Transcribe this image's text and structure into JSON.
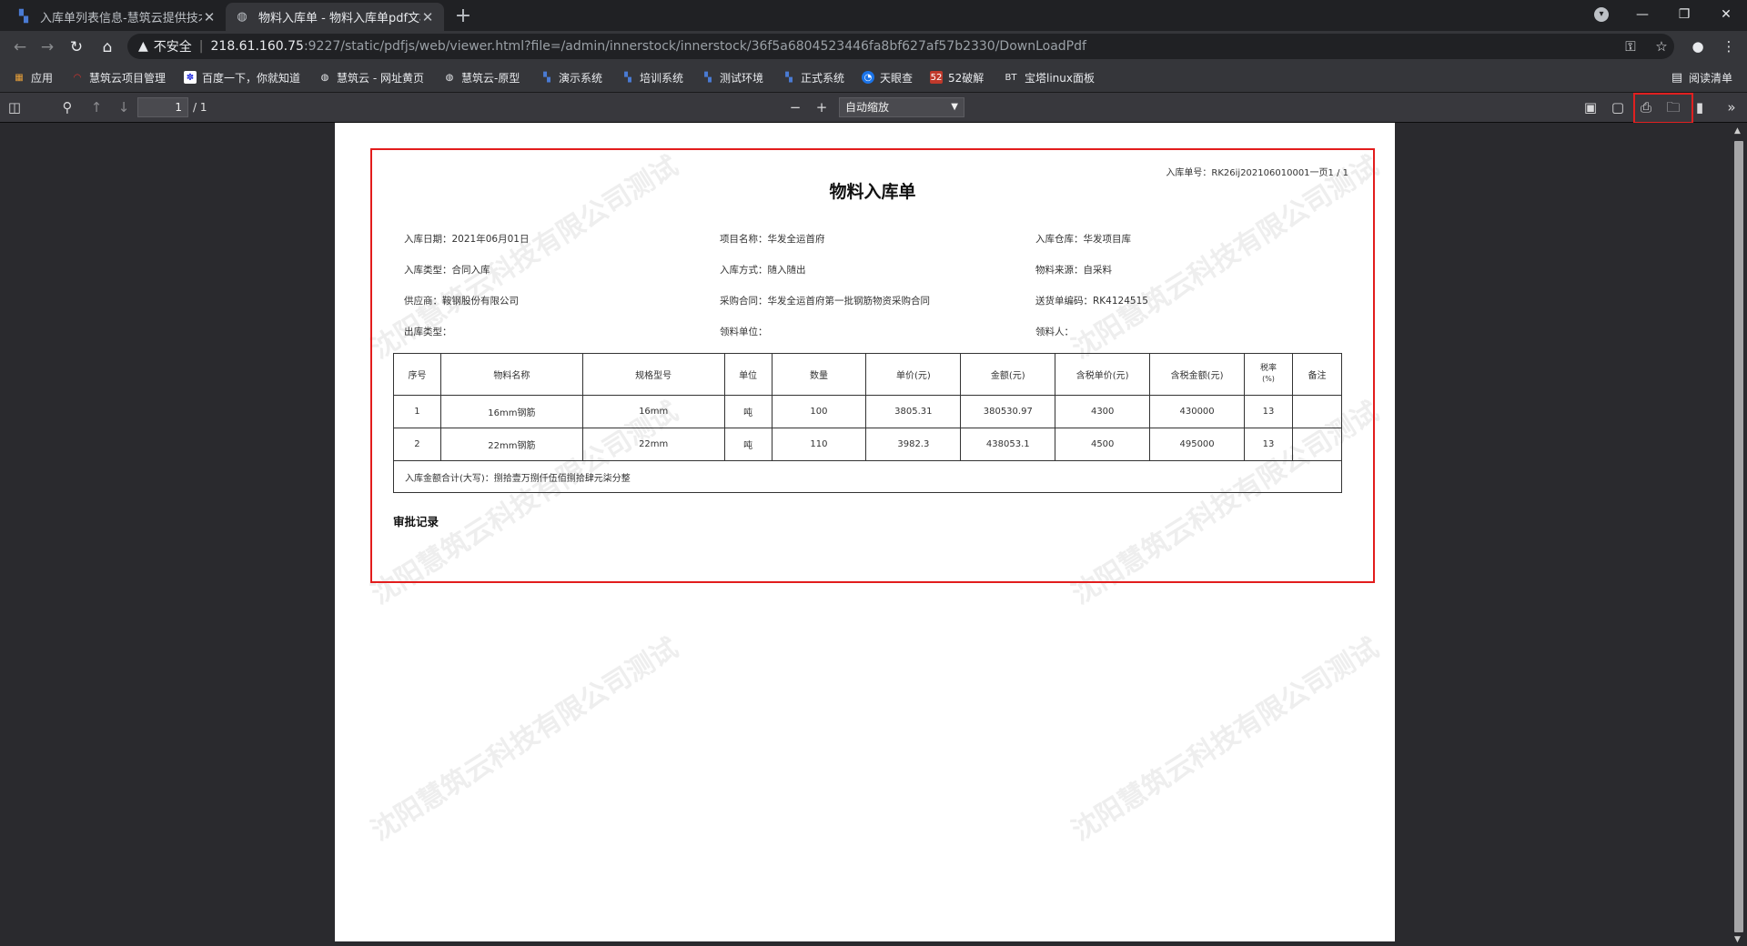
{
  "browser": {
    "tabs": [
      {
        "title": "入库单列表信息-慧筑云提供技术",
        "active": false
      },
      {
        "title": "物料入库单 - 物料入库单pdf文档",
        "active": true
      }
    ],
    "new_tab": "+",
    "address": {
      "security_label": "不安全",
      "host": "218.61.160.75",
      "rest": ":9227/static/pdfjs/web/viewer.html?file=/admin/innerstock/innerstock/36f5a6804523446fa8bf627af57b2330/DownLoadPdf"
    },
    "bookmarks": [
      "应用",
      "慧筑云项目管理",
      "百度一下，你就知道",
      "慧筑云 - 网址黄页",
      "慧筑云-原型",
      "演示系统",
      "培训系统",
      "测试环境",
      "正式系统",
      "天眼查",
      "52破解",
      "宝塔linux面板"
    ],
    "bt_prefix": "BT",
    "reading_list": "阅读清单"
  },
  "pdf_toolbar": {
    "page_number": "1",
    "page_count": "/ 1",
    "zoom": "自动缩放"
  },
  "document": {
    "doc_no": "入库单号：RK26ij202106010001一页1 / 1",
    "title": "物料入库单",
    "fields": {
      "date": "入库日期：2021年06月01日",
      "project": "项目名称：华发全运首府",
      "warehouse": "入库仓库：华发项目库",
      "in_type": "入库类型：合同入库",
      "in_method": "入库方式：随入随出",
      "source": "物料来源：自采料",
      "supplier": "供应商：鞍钢股份有限公司",
      "contract": "采购合同：华发全运首府第一批钢筋物资采购合同",
      "delivery_no": "送货单编码：RK4124515",
      "out_type": "出库类型：",
      "receiver_unit": "领料单位：",
      "receiver": "领料人："
    },
    "table": {
      "headers": {
        "no": "序号",
        "name": "物料名称",
        "spec": "规格型号",
        "unit": "单位",
        "qty": "数量",
        "price": "单价(元)",
        "amount": "金额(元)",
        "tax_price": "含税单价(元)",
        "tax_amount": "含税金额(元)",
        "tax_rate": "税率",
        "tax_rate_unit": "(%)",
        "remark": "备注"
      },
      "rows": [
        [
          "1",
          "16mm钢筋",
          "16mm",
          "吨",
          "100",
          "3805.31",
          "380530.97",
          "4300",
          "430000",
          "13",
          ""
        ],
        [
          "2",
          "22mm钢筋",
          "22mm",
          "吨",
          "110",
          "3982.3",
          "438053.1",
          "4500",
          "495000",
          "13",
          ""
        ]
      ],
      "total": "入库金额合计(大写)：捌拾壹万捌仟伍佰捌拾肆元柒分整"
    },
    "approval": "审批记录",
    "watermark": "沈阳慧筑云科技有限公司测试"
  }
}
